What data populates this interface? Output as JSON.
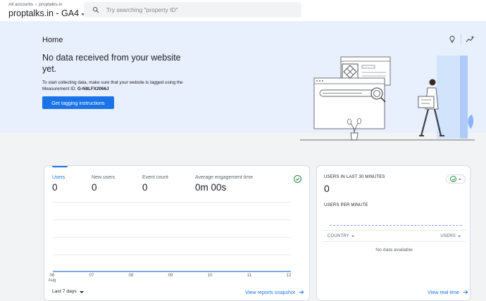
{
  "header": {
    "breadcrumb": [
      "All accounts",
      "proptalks.in"
    ],
    "property_name": "proptalks.in - GA4",
    "search_placeholder": "Try searching \"property ID\""
  },
  "hero": {
    "page_title": "Home",
    "heading": "No data received from your website yet.",
    "body_prefix": "To start collecting data, make sure that your website is tagged using the Measurement ID:",
    "measurement_id": "G-N8LFX2066J",
    "cta_label": "Get tagging instructions",
    "icons": [
      "lightbulb-icon",
      "insights-icon"
    ]
  },
  "overview_card": {
    "metrics": [
      {
        "label": "Users",
        "value": "0",
        "active": true
      },
      {
        "label": "New users",
        "value": "0",
        "active": false
      },
      {
        "label": "Event count",
        "value": "0",
        "active": false
      },
      {
        "label": "Average engagement time",
        "value": "0m 00s",
        "active": false
      }
    ],
    "x_ticks": [
      {
        "day": "06",
        "month": "Aug"
      },
      {
        "day": "07",
        "month": ""
      },
      {
        "day": "08",
        "month": ""
      },
      {
        "day": "09",
        "month": ""
      },
      {
        "day": "10",
        "month": ""
      },
      {
        "day": "11",
        "month": ""
      },
      {
        "day": "12",
        "month": ""
      }
    ],
    "date_range": "Last 7 days",
    "link": "View reports snapshot"
  },
  "realtime_card": {
    "title": "USERS IN LAST 30 MINUTES",
    "value": "0",
    "subtitle": "USERS PER MINUTE",
    "columns": [
      "COUNTRY",
      "USERS"
    ],
    "empty_message": "No data available",
    "link": "View real time"
  },
  "colors": {
    "accent": "#1a73e8",
    "hero_bg": "#e8f0fe",
    "success": "#1e8e3e"
  }
}
